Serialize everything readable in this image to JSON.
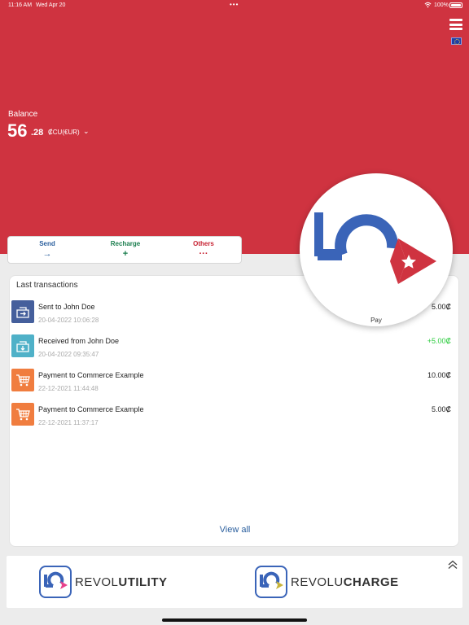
{
  "status_bar": {
    "time": "11:16 AM",
    "date": "Wed Apr 20",
    "dots": "•••",
    "battery": "100%"
  },
  "balance": {
    "label": "Balance",
    "integer": "56",
    "decimal": ".28",
    "currency": "₡CU(€UR)"
  },
  "actions": [
    {
      "label": "Send",
      "icon": "→",
      "color": "#2b5f9e"
    },
    {
      "label": "Recharge",
      "icon": "+",
      "color": "#1a7d4d"
    },
    {
      "label": "Others",
      "icon": "···",
      "color": "#c72232"
    }
  ],
  "transactions": {
    "title": "Last transactions",
    "items": [
      {
        "icon": "send-icon",
        "color": "#455f9c",
        "description": "Sent to John Doe",
        "date": "20-04-2022 10:06:28",
        "amount": "5.00₡",
        "amount_color": "#222222"
      },
      {
        "icon": "receive-icon",
        "color": "#4fb1c8",
        "description": "Received from John Doe",
        "date": "20-04-2022 09:35:47",
        "amount": "+5.00₡",
        "amount_color": "#2ecc40"
      },
      {
        "icon": "cart-icon",
        "color": "#f07d3f",
        "description": "Payment to Commerce Example",
        "date": "22-12-2021 11:44:48",
        "amount": "10.00₡",
        "amount_color": "#222222"
      },
      {
        "icon": "cart-icon",
        "color": "#f07d3f",
        "description": "Payment to Commerce Example",
        "date": "22-12-2021 11:37:17",
        "amount": "5.00₡",
        "amount_color": "#222222"
      }
    ],
    "view_all": "View all"
  },
  "pay": {
    "label": "Pay"
  },
  "footer": {
    "apps": [
      {
        "name_light": "REVOL",
        "name_bold": "UTILITY"
      },
      {
        "name_light": "REVOLU",
        "name_bold": "CHARGE"
      }
    ]
  },
  "colors": {
    "brand_red": "#cf3340",
    "brand_blue": "#3a64b8",
    "link_blue": "#2b5f9e"
  }
}
